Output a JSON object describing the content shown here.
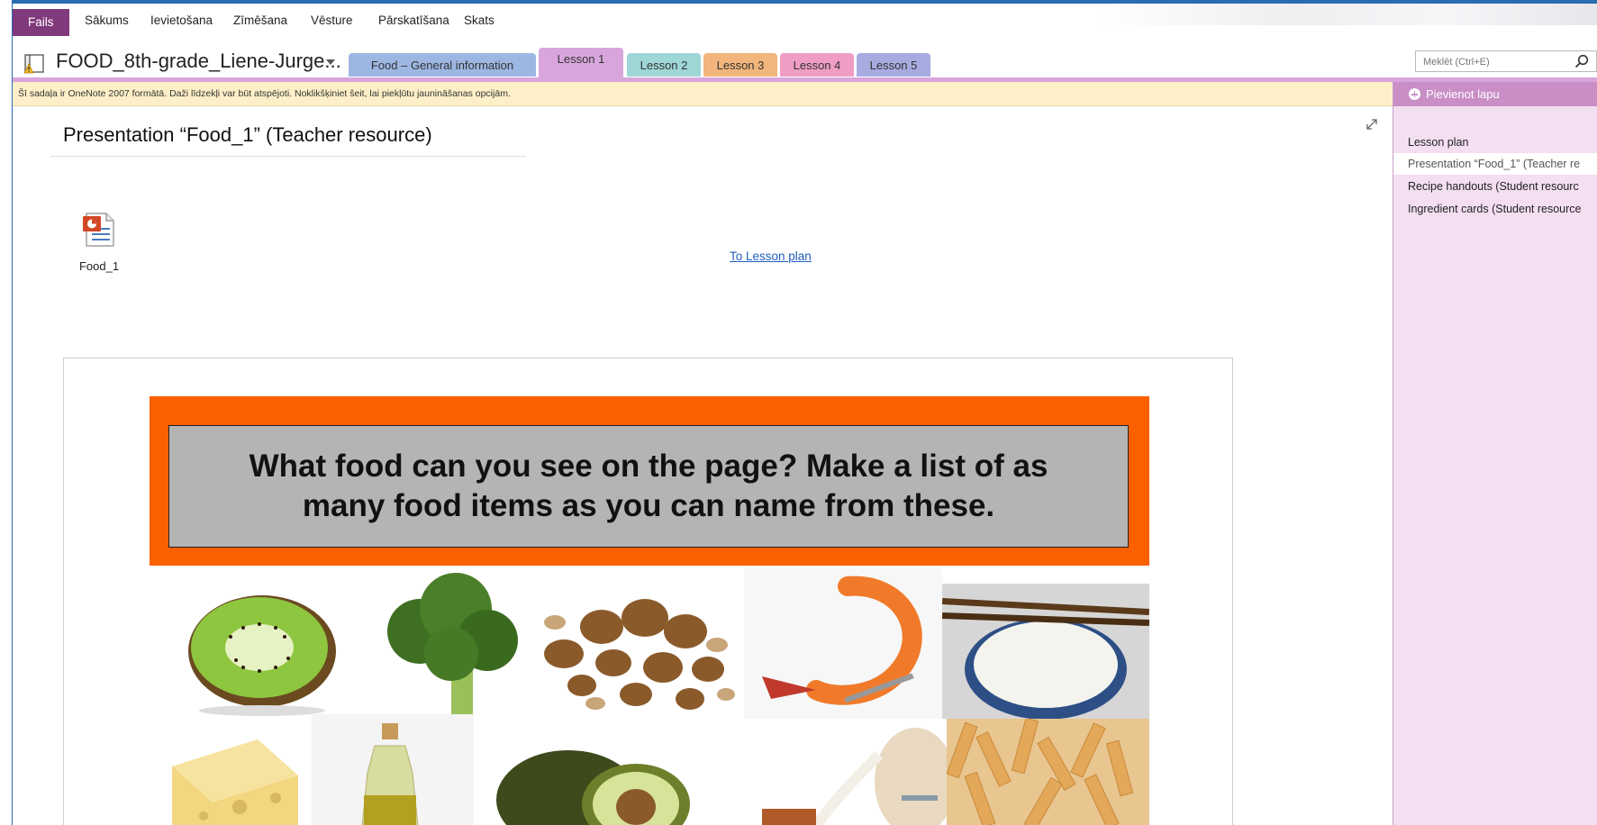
{
  "ribbon": {
    "file_tab": "Fails",
    "tabs": [
      "Sākums",
      "Ievietošana",
      "Zīmēšana",
      "Vēsture",
      "Pārskatīšana",
      "Skats"
    ]
  },
  "notebook": {
    "title": "FOOD_8th-grade_Liene-Jurge...",
    "sections": [
      {
        "label": "Food – General information",
        "color": "#9db7e3"
      },
      {
        "label": "Lesson 1",
        "color": "#d8a6dc",
        "active": true
      },
      {
        "label": "Lesson 2",
        "color": "#9fd6d6"
      },
      {
        "label": "Lesson 3",
        "color": "#f2b57c"
      },
      {
        "label": "Lesson 4",
        "color": "#ef9dc5"
      },
      {
        "label": "Lesson 5",
        "color": "#a7abe0"
      }
    ]
  },
  "search": {
    "placeholder": "Meklēt (Ctrl+E)"
  },
  "infobar": {
    "text": "Šī sadaļa ir OneNote 2007 formātā. Daži līdzekļi var būt atspējoti. Noklikšķiniet šeit, lai piekļūtu jaunināšanas opcijām."
  },
  "pages_pane": {
    "add_page": "Pievienot lapu",
    "pages": [
      {
        "label": "Lesson plan"
      },
      {
        "label": "Presentation “Food_1” (Teacher re",
        "selected": true
      },
      {
        "label": "Recipe handouts (Student resourc"
      },
      {
        "label": "Ingredient cards (Student resource"
      }
    ]
  },
  "page": {
    "title": "Presentation “Food_1” (Teacher resource)",
    "attachment_name": "Food_1",
    "link_text": "To Lesson plan",
    "slide_question": "What food can you see on the page? Make a list of as many food items as you can name from these."
  },
  "colors": {
    "file_tab": "#80397b",
    "tab_strip": "#d8a6dc",
    "pages_pane_bg": "#f3def2",
    "add_page_bg": "#c98ec6",
    "slide_banner": "#fb6000",
    "slide_box": "#b4b4b4",
    "link": "#1f5fbf"
  },
  "food_images": [
    "kiwi",
    "broccoli",
    "nuts",
    "shrimp",
    "rice",
    "cheese",
    "olive-oil",
    "avocado",
    "milk",
    "pasta"
  ]
}
